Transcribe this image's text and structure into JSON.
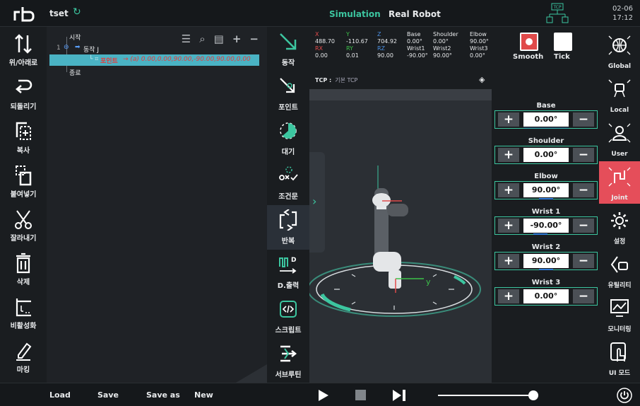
{
  "header": {
    "project": "tset",
    "modes": [
      "Simulation",
      "Real Robot"
    ],
    "active_mode": "Simulation",
    "tcp_label": "TCP",
    "date": "02-06",
    "time": "17:12"
  },
  "left_tools": [
    {
      "label": "위/아래로",
      "icon": "up-down-arrows-icon"
    },
    {
      "label": "되돌리기",
      "icon": "undo-icon"
    },
    {
      "label": "복사",
      "icon": "copy-icon"
    },
    {
      "label": "붙여넣기",
      "icon": "paste-icon"
    },
    {
      "label": "잘라내기",
      "icon": "scissors-icon"
    },
    {
      "label": "삭제",
      "icon": "trash-icon"
    },
    {
      "label": "비활성화",
      "icon": "disable-icon"
    },
    {
      "label": "마킹",
      "icon": "marker-icon"
    }
  ],
  "tree": {
    "start": "시작",
    "move_num": "1",
    "move": "동작 J",
    "point_label": "포인트",
    "point_value": "→ (a) 0.00,0.00,90.00,-90.00,90.00,0.00",
    "end": "종료"
  },
  "mid_tools": [
    {
      "label": "동작",
      "icon": "move-arrow-icon"
    },
    {
      "label": "포인트",
      "icon": "point-icon"
    },
    {
      "label": "대기",
      "icon": "wait-icon"
    },
    {
      "label": "조건문",
      "icon": "condition-icon"
    },
    {
      "label": "반복",
      "icon": "repeat-icon"
    },
    {
      "label": "D.출력",
      "icon": "digital-out-icon"
    },
    {
      "label": "스크립트",
      "icon": "script-icon"
    },
    {
      "label": "서브루틴",
      "icon": "subroutine-icon"
    }
  ],
  "coords": {
    "X": "488.70",
    "Y": "-110.67",
    "Z": "704.92",
    "RX": "0.00",
    "RY": "0.01",
    "RZ": "90.00",
    "Base": "0.00°",
    "Shoulder": "0.00°",
    "Elbow": "90.00°",
    "Wrist1": "-90.00°",
    "Wrist2": "90.00°",
    "Wrist3": "0.00°"
  },
  "coord_labels": {
    "x": "X",
    "y": "Y",
    "z": "Z",
    "rx": "RX",
    "ry": "RY",
    "rz": "RZ",
    "base": "Base",
    "shoulder": "Shoulder",
    "elbow": "Elbow",
    "w1": "Wrist1",
    "w2": "Wrist2",
    "w3": "Wrist3"
  },
  "smooth": "Smooth",
  "tick": "Tick",
  "tcp": {
    "label": "TCP :",
    "value": "기본 TCP"
  },
  "joints": [
    {
      "name": "Base",
      "value": "0.00°"
    },
    {
      "name": "Shoulder",
      "value": "0.00°"
    },
    {
      "name": "Elbow",
      "value": "90.00°"
    },
    {
      "name": "Wrist 1",
      "value": "-90.00°"
    },
    {
      "name": "Wrist 2",
      "value": "90.00°"
    },
    {
      "name": "Wrist 3",
      "value": "0.00°"
    }
  ],
  "joint_btn": {
    "plus": "+",
    "minus": "−"
  },
  "right_tools": [
    {
      "label": "Global",
      "icon": "globe-icon"
    },
    {
      "label": "Local",
      "icon": "local-frame-icon"
    },
    {
      "label": "User",
      "icon": "user-icon"
    },
    {
      "label": "Joint",
      "icon": "joint-icon"
    },
    {
      "label": "설정",
      "icon": "gear-icon"
    },
    {
      "label": "유틸리티",
      "icon": "utility-icon"
    },
    {
      "label": "모니터링",
      "icon": "monitor-icon"
    },
    {
      "label": "UI 모드",
      "icon": "touch-icon"
    }
  ],
  "bottom": {
    "load": "Load",
    "save": "Save",
    "save_as": "Save as",
    "new": "New",
    "speed": 0.95
  },
  "colors": {
    "accent": "#3cc6a0",
    "active_red": "#e54e5a",
    "selection": "#4ab3c4"
  }
}
